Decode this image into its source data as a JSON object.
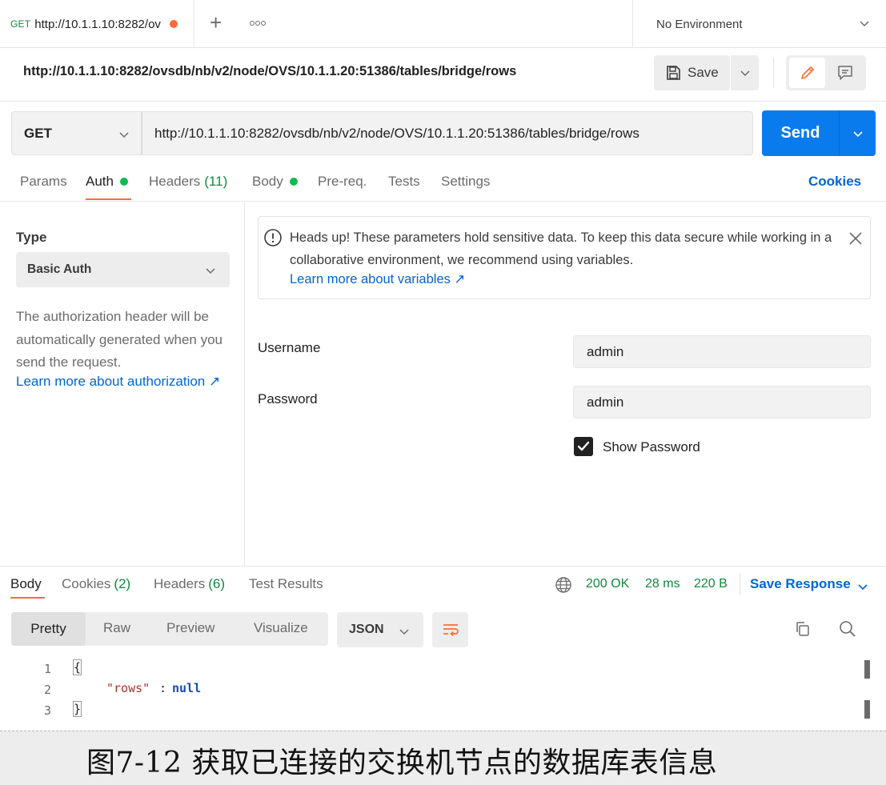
{
  "tabbar": {
    "active_tab": {
      "method": "GET",
      "title": "http://10.1.1.10:8282/ov"
    },
    "environment": "No Environment"
  },
  "header": {
    "url_title": "http://10.1.1.10:8282/ovsdb/nb/v2/node/OVS/10.1.1.20:51386/tables/bridge/rows",
    "save_label": "Save"
  },
  "request": {
    "method": "GET",
    "url": "http://10.1.1.10:8282/ovsdb/nb/v2/node/OVS/10.1.1.20:51386/tables/bridge/rows",
    "send_label": "Send"
  },
  "request_tabs": {
    "params": "Params",
    "auth": "Auth",
    "headers": "Headers",
    "headers_count": "(11)",
    "body": "Body",
    "prereq": "Pre-req.",
    "tests": "Tests",
    "settings": "Settings",
    "cookies": "Cookies"
  },
  "auth": {
    "type_label": "Type",
    "type_value": "Basic Auth",
    "description": "The authorization header will be automatically generated when you send the request.",
    "learn_link": "Learn more about authorization ↗",
    "notice_text": "Heads up! These parameters hold sensitive data. To keep this data secure while working in a collaborative environment, we recommend using variables.",
    "notice_link": "Learn more about variables ↗",
    "username_label": "Username",
    "username_value": "admin",
    "password_label": "Password",
    "password_value": "admin",
    "show_password_label": "Show Password",
    "show_password_checked": true
  },
  "response": {
    "tabs": {
      "body": "Body",
      "cookies": "Cookies",
      "cookies_count": "(2)",
      "headers": "Headers",
      "headers_count": "(6)",
      "test_results": "Test Results"
    },
    "status": "200 OK",
    "time": "28 ms",
    "size": "220 B",
    "save_response": "Save Response",
    "views": [
      "Pretty",
      "Raw",
      "Preview",
      "Visualize"
    ],
    "format": "JSON",
    "code": {
      "line_numbers": [
        "1",
        "2",
        "3"
      ],
      "open_brace": "{",
      "key": "\"rows\"",
      "colon": ":",
      "value": "null",
      "close_brace": "}"
    }
  },
  "caption": "图7-12 获取已连接的交换机节点的数据库表信息",
  "colors": {
    "send_blue": "#097bed",
    "active_orange": "#ff6c37",
    "status_green": "#0f8a3c",
    "link_blue": "#0265d2"
  }
}
